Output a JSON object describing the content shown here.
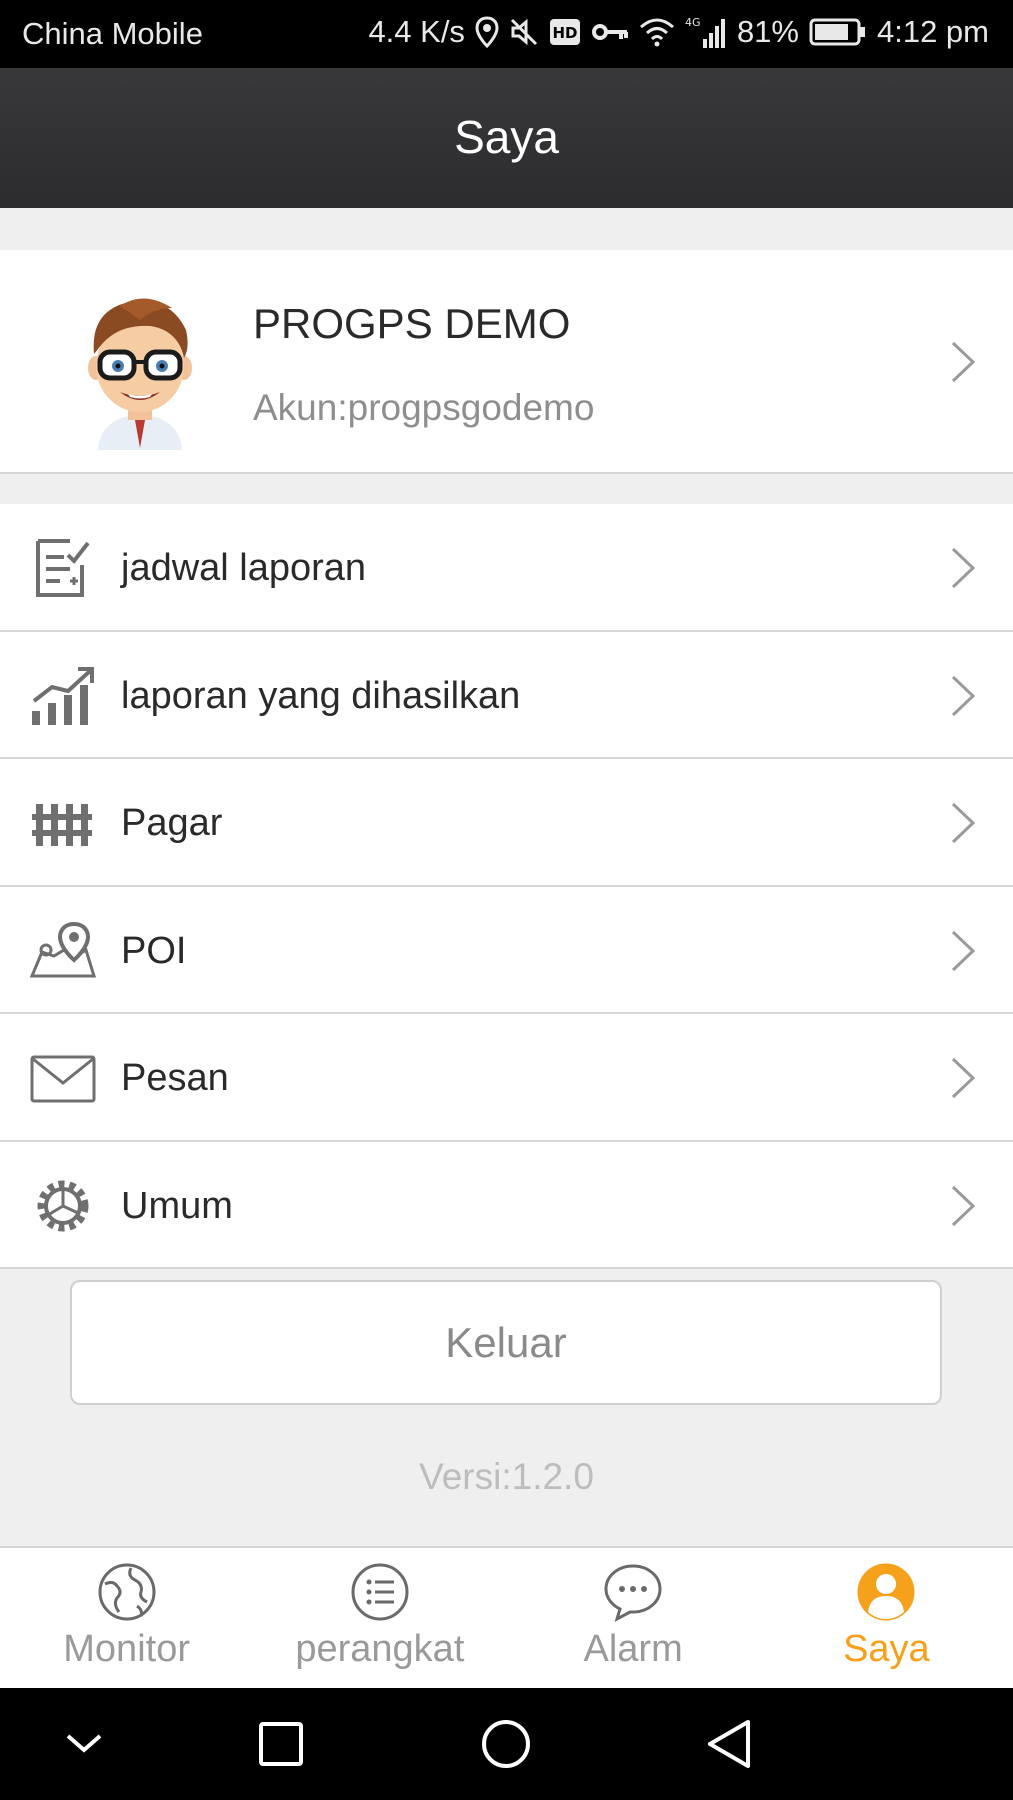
{
  "status_bar": {
    "carrier": "China Mobile",
    "speed": "4.4 K/s",
    "network": "4G",
    "battery": "81%",
    "time": "4:12 pm",
    "icons": [
      "location-icon",
      "mute-icon",
      "hd-icon",
      "vpn-key-icon",
      "wifi-icon",
      "signal-icon",
      "battery-icon"
    ]
  },
  "header": {
    "title": "Saya"
  },
  "profile": {
    "name": "PROGPS DEMO",
    "account": "Akun:progpsgodemo",
    "avatar_icon": "cartoon-avatar"
  },
  "menu": {
    "items": [
      {
        "label": "jadwal laporan",
        "icon": "report-schedule-icon"
      },
      {
        "label": "laporan yang dihasilkan",
        "icon": "chart-icon"
      },
      {
        "label": "Pagar",
        "icon": "fence-icon"
      },
      {
        "label": "POI",
        "icon": "map-pin-icon"
      },
      {
        "label": "Pesan",
        "icon": "mail-icon"
      },
      {
        "label": "Umum",
        "icon": "gear-icon"
      }
    ]
  },
  "logout_label": "Keluar",
  "version": "Versi:1.2.0",
  "tabs": [
    {
      "label": "Monitor",
      "icon": "globe-icon",
      "active": false
    },
    {
      "label": "perangkat",
      "icon": "list-icon",
      "active": false
    },
    {
      "label": "Alarm",
      "icon": "chat-icon",
      "active": false
    },
    {
      "label": "Saya",
      "icon": "user-icon",
      "active": true
    }
  ],
  "colors": {
    "accent": "#f5a11c",
    "header": "#333335",
    "icon_gray": "#6f6f6f"
  }
}
